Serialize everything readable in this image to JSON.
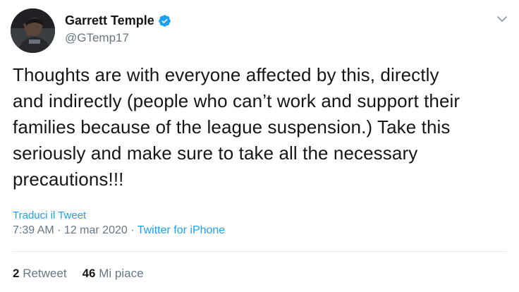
{
  "user": {
    "display_name": "Garrett Temple",
    "handle": "@GTemp17"
  },
  "tweet": {
    "lines": [
      "Thoughts are with everyone affected by this, directly",
      "and indirectly (people who can’t work and support their",
      "families because of the league suspension.) Take this",
      "seriously and make sure to take all the necessary",
      "precautions!!!"
    ],
    "translate_label": "Traduci il Tweet",
    "time": "7:39 AM",
    "separator": " · ",
    "date": "12 mar 2020",
    "source": "Twitter for iPhone"
  },
  "stats": {
    "retweets_count": "2",
    "retweets_label": "Retweet",
    "likes_count": "46",
    "likes_label": "Mi piace"
  },
  "colors": {
    "link": "#1da1f2",
    "secondary": "#657786",
    "primary_text": "#14171a",
    "divider": "#e6ecf0"
  },
  "icons": {
    "verified": "verified-badge-icon",
    "menu": "chevron-down-icon"
  }
}
